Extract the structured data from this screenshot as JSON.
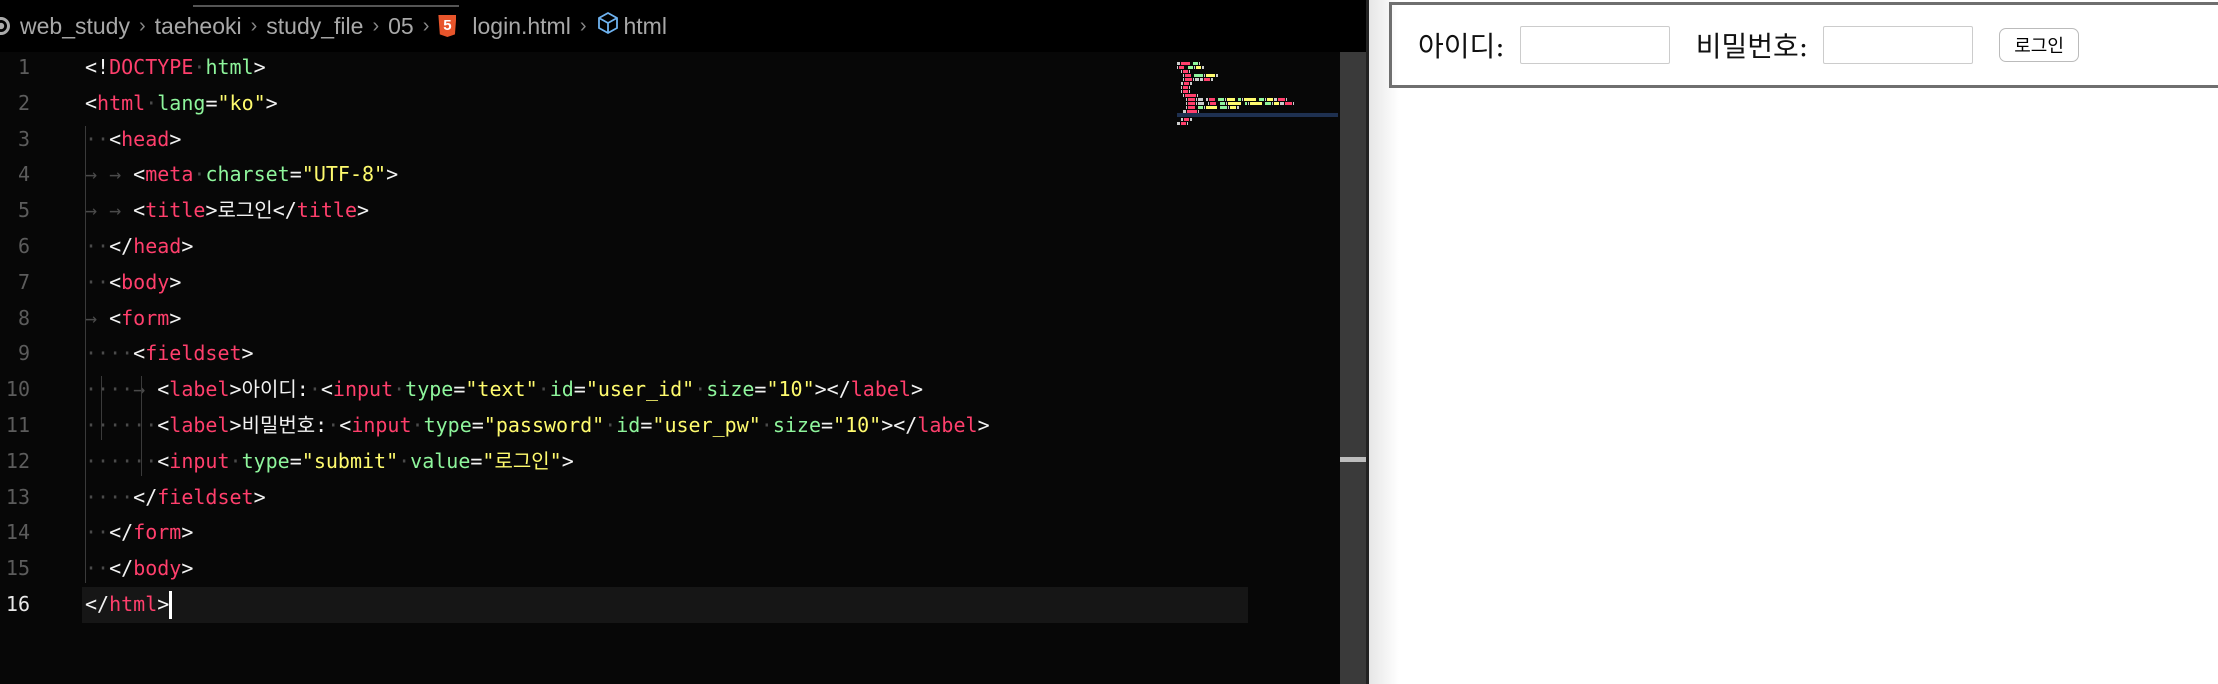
{
  "breadcrumb": {
    "items": [
      "web_study",
      "taeheoki",
      "study_file",
      "05",
      "login.html",
      "html"
    ],
    "icons": {
      "folder_root": "circle-icon",
      "file": "html5-icon",
      "symbol": "cube-icon"
    }
  },
  "editor": {
    "active_line": 16,
    "lines": [
      [
        [
          "p",
          "<!"
        ],
        [
          "t",
          "DOCTYPE"
        ],
        [
          "w",
          "·"
        ],
        [
          "a",
          "html"
        ],
        [
          "p",
          ">"
        ]
      ],
      [
        [
          "p",
          "<"
        ],
        [
          "t",
          "html"
        ],
        [
          "w",
          "·"
        ],
        [
          "a",
          "lang"
        ],
        [
          "p",
          "="
        ],
        [
          "s",
          "\"ko\""
        ],
        [
          "p",
          ">"
        ]
      ],
      [
        [
          "w",
          "··"
        ],
        [
          "p",
          "<"
        ],
        [
          "t",
          "head"
        ],
        [
          "p",
          ">"
        ]
      ],
      [
        [
          "w",
          "→ → "
        ],
        [
          "p",
          "<"
        ],
        [
          "t",
          "meta"
        ],
        [
          "w",
          "·"
        ],
        [
          "a",
          "charset"
        ],
        [
          "p",
          "="
        ],
        [
          "s",
          "\"UTF-8\""
        ],
        [
          "p",
          ">"
        ]
      ],
      [
        [
          "w",
          "→ → "
        ],
        [
          "p",
          "<"
        ],
        [
          "t",
          "title"
        ],
        [
          "p",
          ">"
        ],
        [
          "x",
          "로그인"
        ],
        [
          "p",
          "</"
        ],
        [
          "t",
          "title"
        ],
        [
          "p",
          ">"
        ]
      ],
      [
        [
          "w",
          "··"
        ],
        [
          "p",
          "</"
        ],
        [
          "t",
          "head"
        ],
        [
          "p",
          ">"
        ]
      ],
      [
        [
          "w",
          "··"
        ],
        [
          "p",
          "<"
        ],
        [
          "t",
          "body"
        ],
        [
          "p",
          ">"
        ]
      ],
      [
        [
          "w",
          "→ "
        ],
        [
          "p",
          "<"
        ],
        [
          "t",
          "form"
        ],
        [
          "p",
          ">"
        ]
      ],
      [
        [
          "w",
          "····"
        ],
        [
          "p",
          "<"
        ],
        [
          "t",
          "fieldset"
        ],
        [
          "p",
          ">"
        ]
      ],
      [
        [
          "w",
          "····→ "
        ],
        [
          "p",
          "<"
        ],
        [
          "t",
          "label"
        ],
        [
          "p",
          ">"
        ],
        [
          "x",
          "아이디:"
        ],
        [
          "w",
          "·"
        ],
        [
          "p",
          "<"
        ],
        [
          "t",
          "input"
        ],
        [
          "w",
          "·"
        ],
        [
          "a",
          "type"
        ],
        [
          "p",
          "="
        ],
        [
          "s",
          "\"text\""
        ],
        [
          "w",
          "·"
        ],
        [
          "a",
          "id"
        ],
        [
          "p",
          "="
        ],
        [
          "s",
          "\"user_id\""
        ],
        [
          "w",
          "·"
        ],
        [
          "a",
          "size"
        ],
        [
          "p",
          "="
        ],
        [
          "s",
          "\"10\""
        ],
        [
          "p",
          "></"
        ],
        [
          "t",
          "label"
        ],
        [
          "p",
          ">"
        ]
      ],
      [
        [
          "w",
          "······"
        ],
        [
          "p",
          "<"
        ],
        [
          "t",
          "label"
        ],
        [
          "p",
          ">"
        ],
        [
          "x",
          "비밀번호:"
        ],
        [
          "w",
          "·"
        ],
        [
          "p",
          "<"
        ],
        [
          "t",
          "input"
        ],
        [
          "w",
          "·"
        ],
        [
          "a",
          "type"
        ],
        [
          "p",
          "="
        ],
        [
          "s",
          "\"password\""
        ],
        [
          "w",
          "·"
        ],
        [
          "a",
          "id"
        ],
        [
          "p",
          "="
        ],
        [
          "s",
          "\"user_pw\""
        ],
        [
          "w",
          "·"
        ],
        [
          "a",
          "size"
        ],
        [
          "p",
          "="
        ],
        [
          "s",
          "\"10\""
        ],
        [
          "p",
          "></"
        ],
        [
          "t",
          "label"
        ],
        [
          "p",
          ">"
        ]
      ],
      [
        [
          "w",
          "······"
        ],
        [
          "p",
          "<"
        ],
        [
          "t",
          "input"
        ],
        [
          "w",
          "·"
        ],
        [
          "a",
          "type"
        ],
        [
          "p",
          "="
        ],
        [
          "s",
          "\"submit\""
        ],
        [
          "w",
          "·"
        ],
        [
          "a",
          "value"
        ],
        [
          "p",
          "="
        ],
        [
          "s",
          "\"로그인\""
        ],
        [
          "p",
          ">"
        ]
      ],
      [
        [
          "w",
          "····"
        ],
        [
          "p",
          "</"
        ],
        [
          "t",
          "fieldset"
        ],
        [
          "p",
          ">"
        ]
      ],
      [
        [
          "w",
          "··"
        ],
        [
          "p",
          "</"
        ],
        [
          "t",
          "form"
        ],
        [
          "p",
          ">"
        ]
      ],
      [
        [
          "w",
          "··"
        ],
        [
          "p",
          "</"
        ],
        [
          "t",
          "body"
        ],
        [
          "p",
          ">"
        ]
      ],
      [
        [
          "p",
          "</"
        ],
        [
          "t",
          "html"
        ],
        [
          "p",
          ">"
        ]
      ]
    ]
  },
  "preview": {
    "id_label": "아이디:",
    "pw_label": "비밀번호:",
    "id_value": "",
    "pw_value": "",
    "submit_label": "로그인"
  },
  "colors": {
    "tag": "#ff3f6c",
    "attr": "#8ef59c",
    "string": "#fffb6e",
    "html5": "#e8552b",
    "symbol": "#6fb3f0"
  }
}
